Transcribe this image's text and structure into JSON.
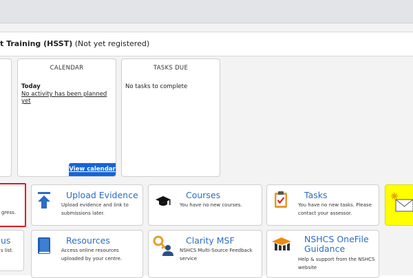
{
  "qualification": {
    "name": "t Training (HSST)",
    "status": "(Not yet registered)"
  },
  "calendar": {
    "title": "CALENDAR",
    "today": "Today",
    "empty": "No activity has been planned yet",
    "button": "View calendar"
  },
  "tasks_due": {
    "title": "TASKS DUE",
    "empty": "No tasks to complete"
  },
  "tiles": {
    "progress_partial": {
      "desc": "gress."
    },
    "upload": {
      "title": "Upload Evidence",
      "desc": "Upload evidence and link to submissions later.",
      "icon": "upload-arrow-icon"
    },
    "courses": {
      "title": "Courses",
      "desc": "You have no new courses.",
      "icon": "graduation-cap-icon"
    },
    "tasks": {
      "title": "Tasks",
      "desc": "You have no new tasks. Please contact your assessor.",
      "icon": "clipboard-check-icon"
    },
    "messages": {
      "icon": "envelope-icon"
    },
    "status_partial": {
      "title": "us",
      "desc": "s list."
    },
    "resources": {
      "title": "Resources",
      "desc": "Access online resources uploaded by your centre.",
      "icon": "book-icon"
    },
    "clarity": {
      "title": "Clarity MSF",
      "desc": "NSHCS Multi-Source Feedback service",
      "icon": "key-user-icon"
    },
    "onefile": {
      "title": "NSHCS OneFile Guidance",
      "desc": "Help & support from the NSHCS website",
      "icon": "mortarboard-icon"
    }
  },
  "colors": {
    "accent": "#1565d8",
    "tile_title": "#2b6cc4",
    "highlight_border": "#e8121e",
    "yellow_tile": "#ffff00"
  }
}
